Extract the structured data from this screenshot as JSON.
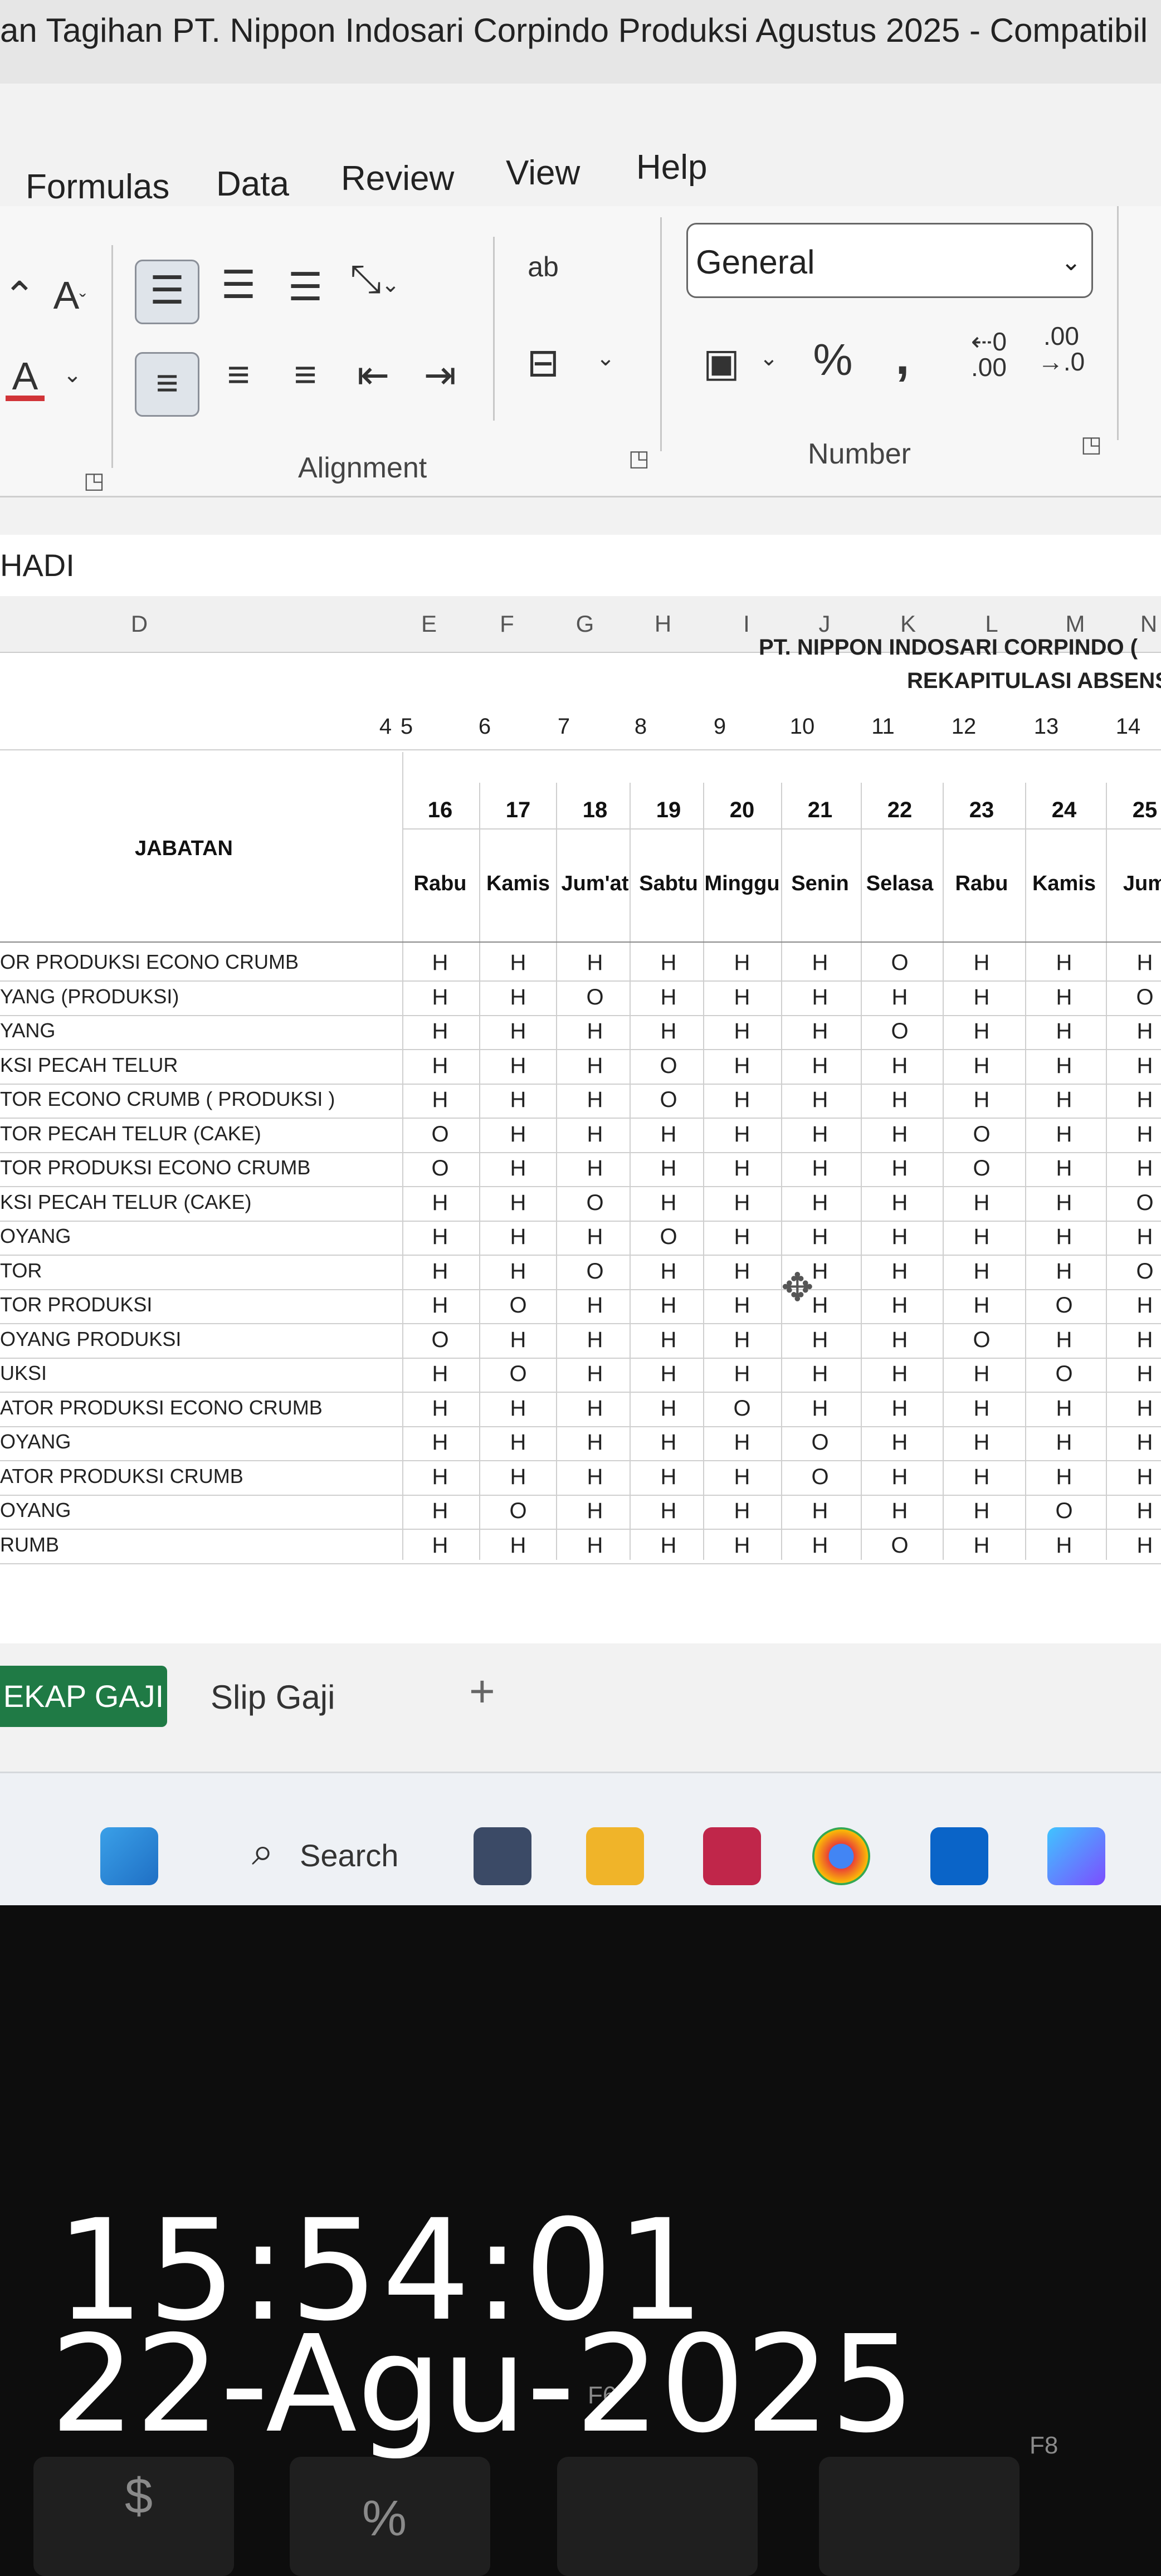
{
  "title": "an Tagihan PT. Nippon Indosari Corpindo Produksi Agustus 2025  -  Compatibil",
  "ribbon_tabs": [
    "Formulas",
    "Data",
    "Review",
    "View",
    "Help"
  ],
  "ribbon": {
    "alignment_label": "Alignment",
    "number_label": "Number",
    "number_format": "General",
    "wrap_text_glyph": "ab",
    "percent": "%",
    "comma": ","
  },
  "formula_bar_text": "HADI",
  "columns": [
    "D",
    "E",
    "F",
    "G",
    "H",
    "I",
    "J",
    "K",
    "L",
    "M",
    "N"
  ],
  "sheet": {
    "company": "PT. NIPPON INDOSARI CORPINDO (",
    "subtitle": "REKAPITULASI ABSENS",
    "jabatan_header": "JABATAN",
    "index_row": [
      "4",
      "5",
      "6",
      "7",
      "8",
      "9",
      "10",
      "11",
      "12",
      "13",
      "14"
    ],
    "dates": [
      "16",
      "17",
      "18",
      "19",
      "20",
      "21",
      "22",
      "23",
      "24",
      "25"
    ],
    "days": [
      "Rabu",
      "Kamis",
      "Jum'at",
      "Sabtu",
      "Minggu",
      "Senin",
      "Selasa",
      "Rabu",
      "Kamis",
      "Jum"
    ],
    "rows": [
      {
        "jabatan": "OR PRODUKSI ECONO CRUMB",
        "att": [
          "H",
          "H",
          "H",
          "H",
          "H",
          "H",
          "O",
          "H",
          "H",
          "H"
        ]
      },
      {
        "jabatan": "YANG (PRODUKSI)",
        "att": [
          "H",
          "H",
          "O",
          "H",
          "H",
          "H",
          "H",
          "H",
          "H",
          "O"
        ]
      },
      {
        "jabatan": "YANG",
        "att": [
          "H",
          "H",
          "H",
          "H",
          "H",
          "H",
          "O",
          "H",
          "H",
          "H"
        ]
      },
      {
        "jabatan": "KSI PECAH TELUR",
        "att": [
          "H",
          "H",
          "H",
          "O",
          "H",
          "H",
          "H",
          "H",
          "H",
          "H"
        ]
      },
      {
        "jabatan": "TOR ECONO CRUMB ( PRODUKSI )",
        "att": [
          "H",
          "H",
          "H",
          "O",
          "H",
          "H",
          "H",
          "H",
          "H",
          "H"
        ]
      },
      {
        "jabatan": "TOR PECAH TELUR (CAKE)",
        "att": [
          "O",
          "H",
          "H",
          "H",
          "H",
          "H",
          "H",
          "O",
          "H",
          "H"
        ]
      },
      {
        "jabatan": "TOR PRODUKSI ECONO CRUMB",
        "att": [
          "O",
          "H",
          "H",
          "H",
          "H",
          "H",
          "H",
          "O",
          "H",
          "H"
        ]
      },
      {
        "jabatan": "KSI PECAH TELUR (CAKE)",
        "att": [
          "H",
          "H",
          "O",
          "H",
          "H",
          "H",
          "H",
          "H",
          "H",
          "O"
        ]
      },
      {
        "jabatan": "OYANG",
        "att": [
          "H",
          "H",
          "H",
          "O",
          "H",
          "H",
          "H",
          "H",
          "H",
          "H"
        ]
      },
      {
        "jabatan": "TOR",
        "att": [
          "H",
          "H",
          "O",
          "H",
          "H",
          "H",
          "H",
          "H",
          "H",
          "O"
        ]
      },
      {
        "jabatan": "TOR PRODUKSI",
        "att": [
          "H",
          "O",
          "H",
          "H",
          "H",
          "H",
          "H",
          "H",
          "O",
          "H"
        ]
      },
      {
        "jabatan": "OYANG PRODUKSI",
        "att": [
          "O",
          "H",
          "H",
          "H",
          "H",
          "H",
          "H",
          "O",
          "H",
          "H"
        ]
      },
      {
        "jabatan": "UKSI",
        "att": [
          "H",
          "O",
          "H",
          "H",
          "H",
          "H",
          "H",
          "H",
          "O",
          "H"
        ]
      },
      {
        "jabatan": "ATOR PRODUKSI ECONO CRUMB",
        "att": [
          "H",
          "H",
          "H",
          "H",
          "O",
          "H",
          "H",
          "H",
          "H",
          "H"
        ]
      },
      {
        "jabatan": "OYANG",
        "att": [
          "H",
          "H",
          "H",
          "H",
          "H",
          "O",
          "H",
          "H",
          "H",
          "H"
        ]
      },
      {
        "jabatan": "ATOR PRODUKSI CRUMB",
        "att": [
          "H",
          "H",
          "H",
          "H",
          "H",
          "O",
          "H",
          "H",
          "H",
          "H"
        ]
      },
      {
        "jabatan": "OYANG",
        "att": [
          "H",
          "O",
          "H",
          "H",
          "H",
          "H",
          "H",
          "H",
          "O",
          "H"
        ]
      },
      {
        "jabatan": "RUMB",
        "att": [
          "H",
          "H",
          "H",
          "H",
          "H",
          "H",
          "O",
          "H",
          "H",
          "H"
        ]
      }
    ]
  },
  "sheet_tabs": {
    "active": "EKAP GAJI",
    "other": "Slip Gaji",
    "add": "+"
  },
  "taskbar": {
    "search": "Search"
  },
  "overlay": {
    "time": "15:54:01",
    "date": "22-Agu-2025"
  },
  "keyboard_labels": {
    "dollar": "$",
    "percent": "%",
    "f6": "F6",
    "f8": "F8"
  },
  "colors": {
    "accent_green": "#1f7a45",
    "grid_line": "#cfcfcf"
  }
}
